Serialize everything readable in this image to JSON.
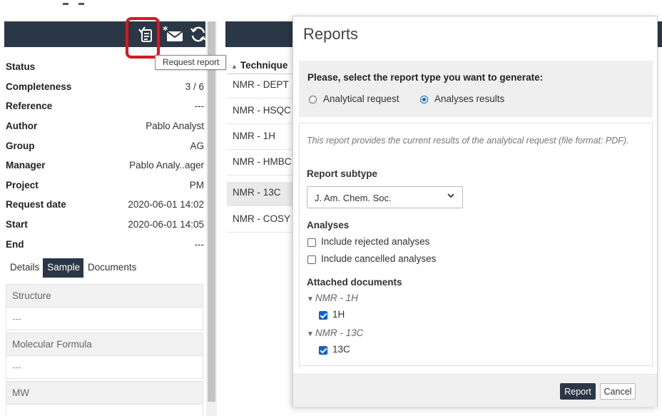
{
  "toolbar": {
    "tooltip": "Request report",
    "icons": [
      "request-report-icon",
      "send-email-icon",
      "refresh-icon"
    ]
  },
  "properties": [
    {
      "label": "Status",
      "value": ""
    },
    {
      "label": "Completeness",
      "value": "3 / 6"
    },
    {
      "label": "Reference",
      "value": "---"
    },
    {
      "label": "Author",
      "value": "Pablo Analyst"
    },
    {
      "label": "Group",
      "value": "AG"
    },
    {
      "label": "Manager",
      "value": "Pablo Analy..ager"
    },
    {
      "label": "Project",
      "value": "PM"
    },
    {
      "label": "Request date",
      "value": "2020-06-01 14:02"
    },
    {
      "label": "Start",
      "value": "2020-06-01 14:05"
    },
    {
      "label": "End",
      "value": "---"
    }
  ],
  "subtabs": [
    {
      "label": "Details",
      "active": false
    },
    {
      "label": "Sample",
      "active": true
    },
    {
      "label": "Documents",
      "active": false
    }
  ],
  "sample_fields": [
    {
      "label": "Structure",
      "value": "---"
    },
    {
      "label": "Molecular Formula",
      "value": "---"
    },
    {
      "label": "MW",
      "value": "---"
    }
  ],
  "techniques": {
    "header": "Technique",
    "sort_icon": "▲",
    "rows": [
      "NMR - DEPT",
      "NMR - HSQC",
      "NMR - 1H",
      "NMR - HMBC",
      "NMR - 13C",
      "NMR - COSY"
    ],
    "selected": "NMR - 13C"
  },
  "modal": {
    "title": "Reports",
    "prompt": "Please, select the report type you want to generate:",
    "report_types": [
      {
        "label": "Analytical request",
        "checked": false
      },
      {
        "label": "Analyses results",
        "checked": true
      }
    ],
    "description": "This report provides the current results of the analytical request (file format: PDF).",
    "subtype_heading": "Report subtype",
    "subtype_value": "J. Am. Chem. Soc.",
    "analyses_heading": "Analyses",
    "analyses_options": [
      {
        "label": "Include rejected analyses",
        "checked": false
      },
      {
        "label": "Include cancelled analyses",
        "checked": false
      }
    ],
    "attached_heading": "Attached documents",
    "attached_groups": [
      {
        "name": "NMR - 1H",
        "doc": "1H",
        "checked": true
      },
      {
        "name": "NMR - 13C",
        "doc": "13C",
        "checked": true
      }
    ],
    "report_button": "Report",
    "cancel_button": "Cancel"
  },
  "colors": {
    "header_bg": "#2a3746",
    "highlight": "#e0141e",
    "accent": "#0a62d8"
  }
}
